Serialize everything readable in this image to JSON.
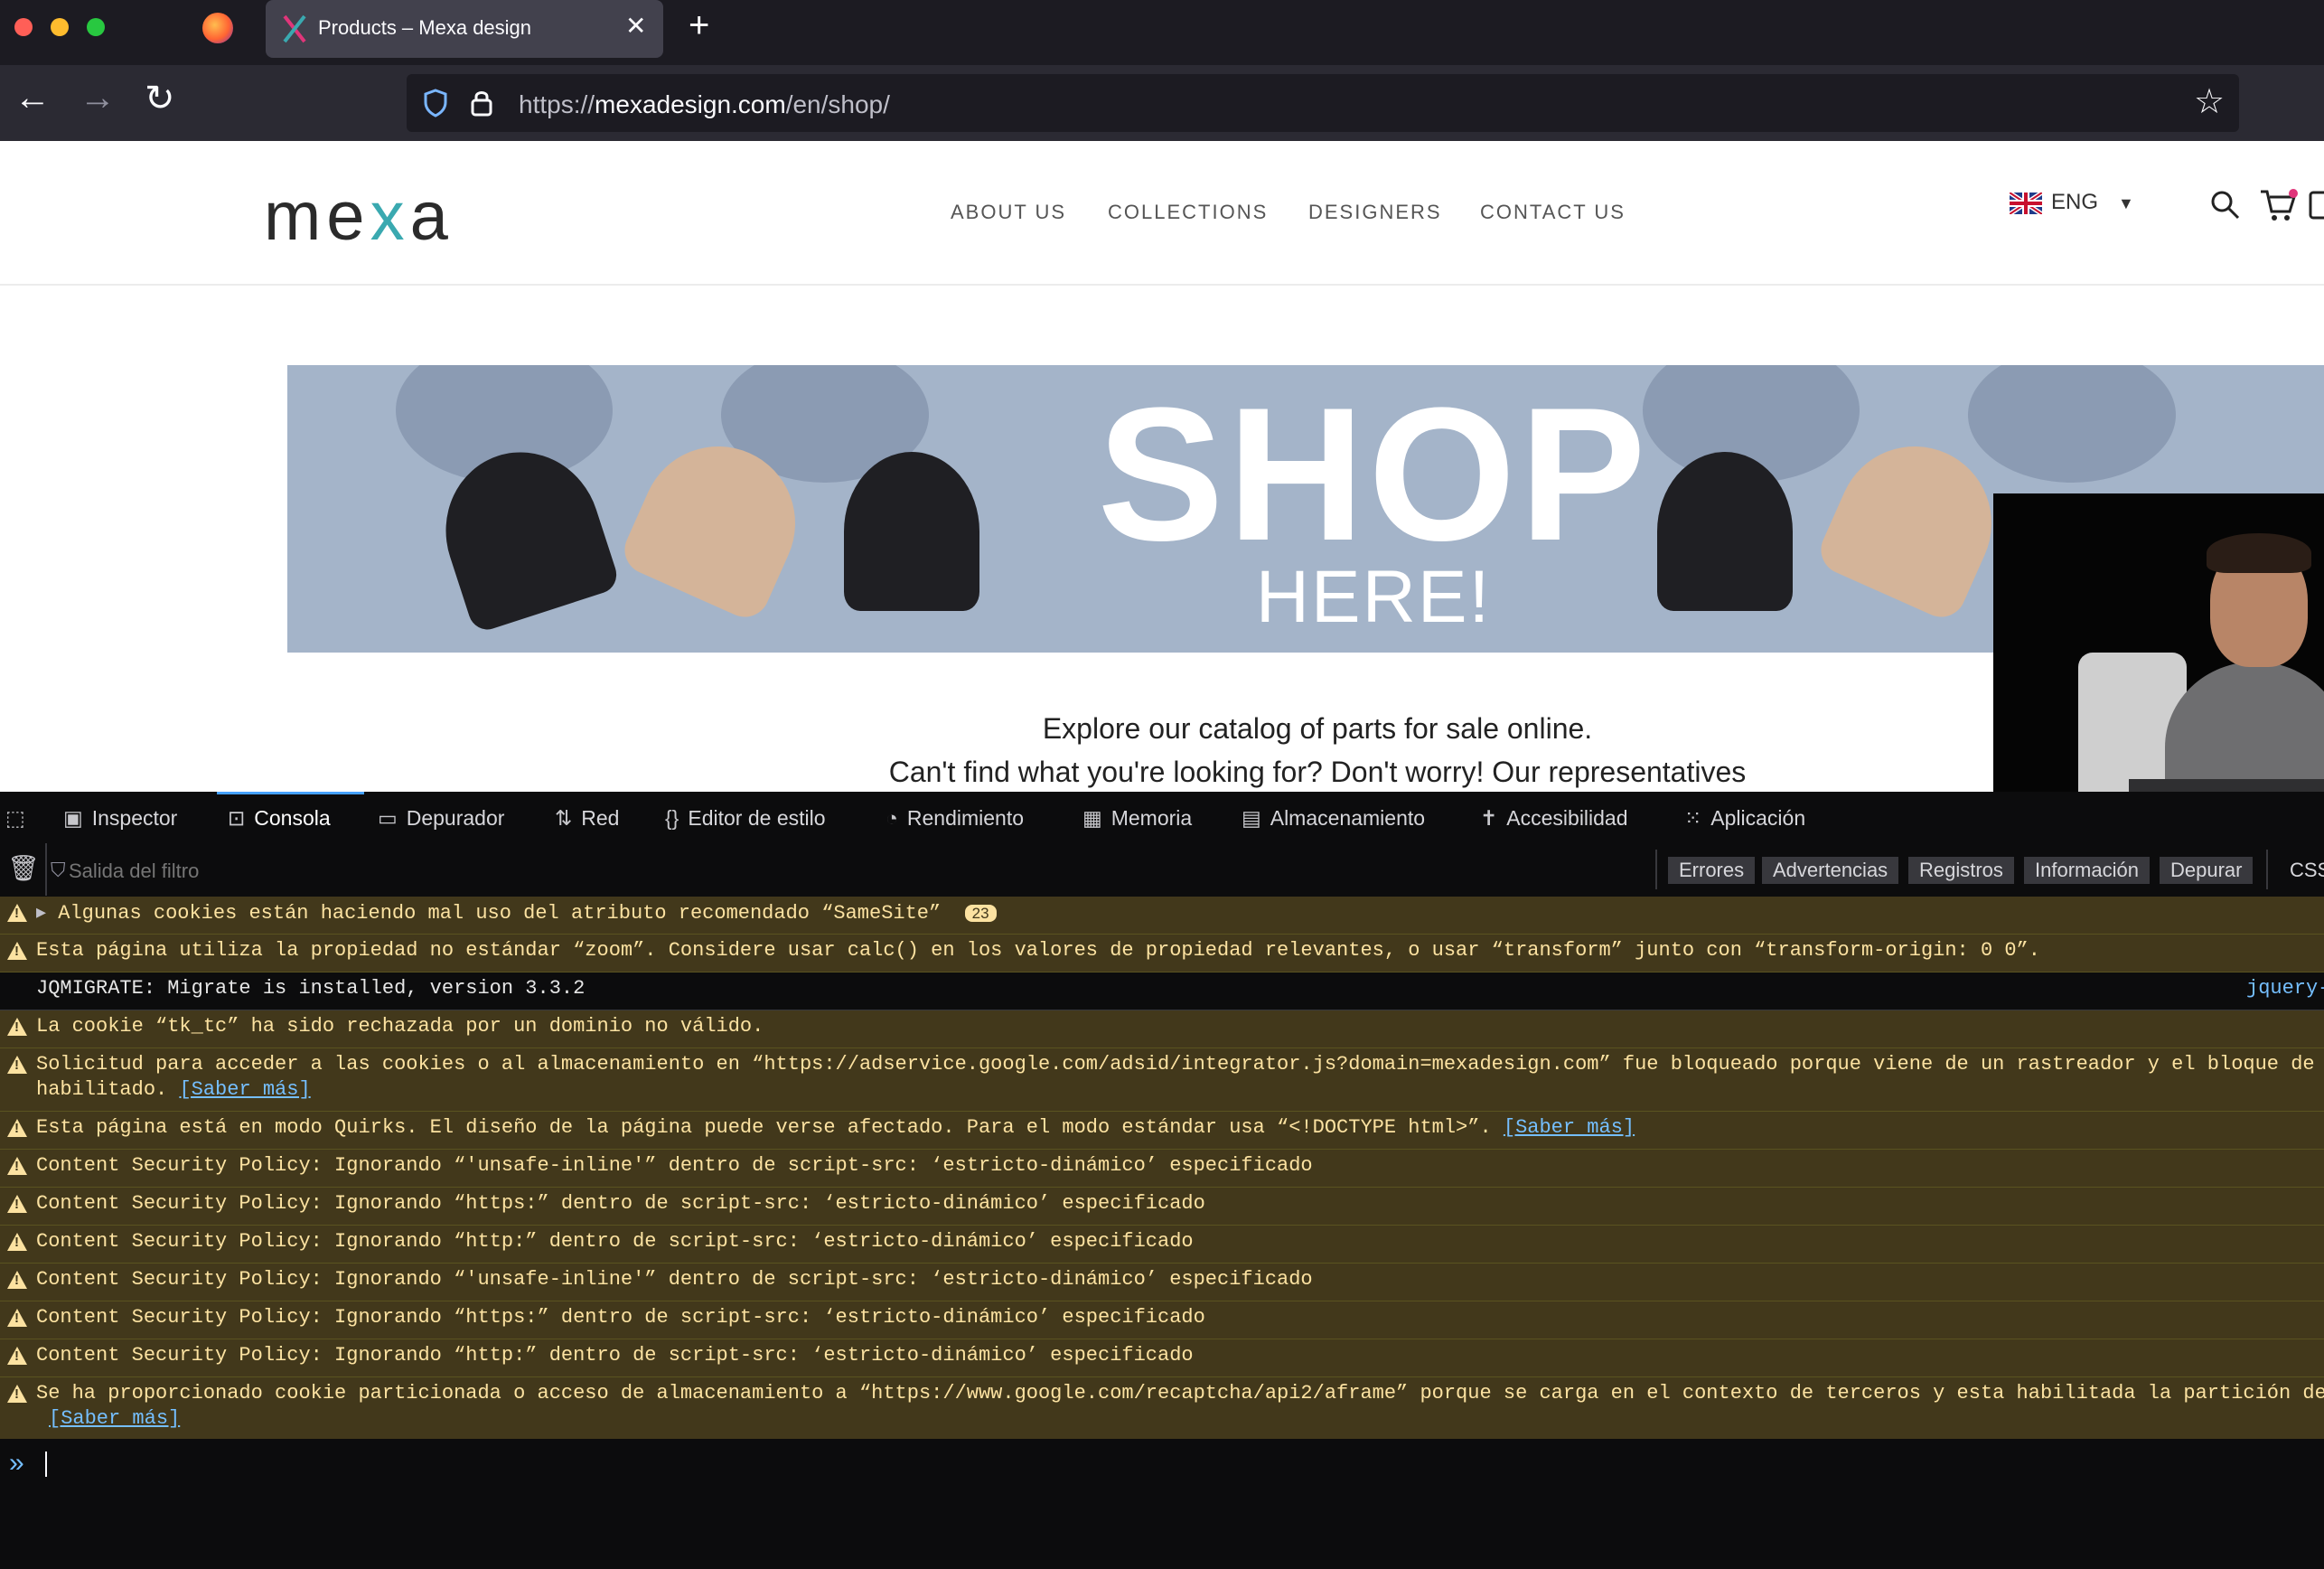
{
  "browser": {
    "tab_title": "Products – Mexa design",
    "url_prefix": "https://",
    "url_host": "mexadesign.com",
    "url_path": "/en/shop/"
  },
  "site": {
    "logo_prefix": "me",
    "logo_x": "x",
    "logo_suffix": "a",
    "nav": [
      "ABOUT US",
      "COLLECTIONS",
      "DESIGNERS",
      "CONTACT US"
    ],
    "language": "ENG",
    "banner_title": "SHOP",
    "banner_subtitle": "HERE!",
    "intro_line1": "Explore our catalog of parts for sale online.",
    "intro_line2": "Can't find what you're looking for? Don't worry! Our representatives"
  },
  "devtools": {
    "tabs": [
      "Inspector",
      "Consola",
      "Depurador",
      "Red",
      "Editor de estilo",
      "Rendimiento",
      "Memoria",
      "Almacenamiento",
      "Accesibilidad",
      "Aplicación"
    ],
    "filter_placeholder": "Salida del filtro",
    "filter_buttons": [
      "Errores",
      "Advertencias",
      "Registros",
      "Información",
      "Depurar"
    ],
    "css_label": "CSS",
    "messages": [
      {
        "text": "Algunas cookies están haciendo mal uso del atributo recomendado “SameSite”",
        "badge": "23"
      },
      {
        "text": "Esta página utiliza la propiedad no estándar “zoom”. Considere usar calc() en los valores de propiedad relevantes, o usar “transform” junto con “transform-origin: 0 0”."
      },
      {
        "text": "JQMIGRATE: Migrate is installed, version 3.3.2",
        "source": "jquery-"
      },
      {
        "text": "La cookie “tk_tc” ha sido rechazada por un dominio no válido."
      },
      {
        "text": "Solicitud para acceder a las cookies o al almacenamiento en “https://adservice.google.com/adsid/integrator.js?domain=mexadesign.com” fue bloqueado porque viene de un rastreador y el bloque de",
        "line2": "habilitado.",
        "link": "[Saber más]"
      },
      {
        "text": "Esta página está en modo Quirks. El diseño de la página puede verse afectado. Para el modo estándar usa “<!DOCTYPE html>”.",
        "link": "[Saber más]"
      },
      {
        "text": "Content Security Policy: Ignorando “'unsafe-inline'” dentro de script-src: ‘estricto-dinámico’ especificado"
      },
      {
        "text": "Content Security Policy: Ignorando “https:” dentro de script-src: ‘estricto-dinámico’ especificado"
      },
      {
        "text": "Content Security Policy: Ignorando “http:” dentro de script-src: ‘estricto-dinámico’ especificado"
      },
      {
        "text": "Content Security Policy: Ignorando “'unsafe-inline'” dentro de script-src: ‘estricto-dinámico’ especificado"
      },
      {
        "text": "Content Security Policy: Ignorando “https:” dentro de script-src: ‘estricto-dinámico’ especificado"
      },
      {
        "text": "Content Security Policy: Ignorando “http:” dentro de script-src: ‘estricto-dinámico’ especificado"
      },
      {
        "text": "Se ha proporcionado cookie particionada o acceso de almacenamiento a “https://www.google.com/recaptcha/api2/aframe” porque se carga en el contexto de terceros y esta habilitada la partición de",
        "link": "[Saber más]"
      }
    ]
  }
}
